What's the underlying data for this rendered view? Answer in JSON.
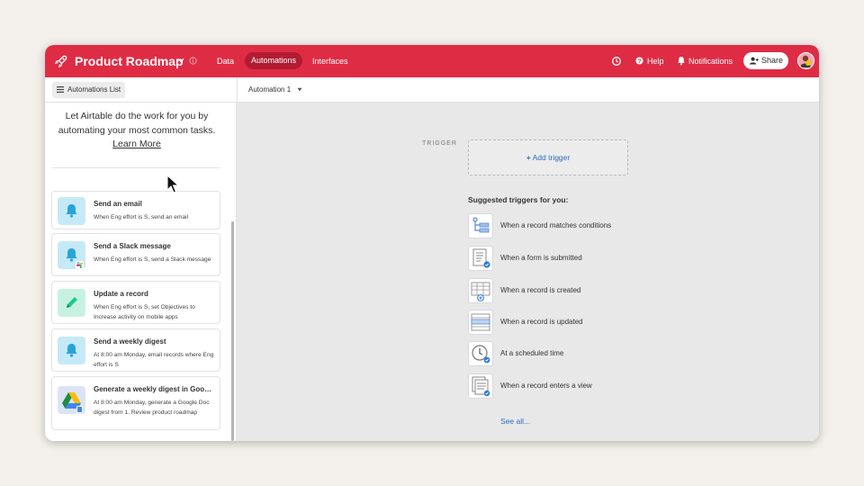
{
  "header": {
    "title": "Product Roadmap",
    "nav": [
      "Data",
      "Automations",
      "Interfaces"
    ],
    "help_label": "Help",
    "notifications_label": "Notifications",
    "share_label": "Share",
    "bg_color": "#df2c45"
  },
  "toolbar": {
    "list_label": "Automations List",
    "automation_selector": "Automation 1"
  },
  "left_panel": {
    "intro_text": "Let Airtable do the work for you by automating your most common tasks.",
    "learn_more": "Learn More",
    "templates": [
      {
        "title": "Send an email",
        "description": "When Eng effort is S, send an email",
        "icon": "bell-icon"
      },
      {
        "title": "Send a Slack message",
        "description": "When Eng effort is S, send a Slack message",
        "icon": "bell-slack-icon"
      },
      {
        "title": "Update a record",
        "description": "When Eng effort is S, set Objectives to Increase activity on mobile apps",
        "icon": "pencil-icon"
      },
      {
        "title": "Send a weekly digest",
        "description": "At 8:00 am Monday, email records where Eng effort is S",
        "icon": "bell-icon"
      },
      {
        "title": "Generate a weekly digest in Goo…",
        "description": "At 8:00 am Monday, generate a Google Doc digest from 1. Review product roadmap",
        "icon": "google-drive-icon"
      }
    ]
  },
  "canvas": {
    "trigger_label": "TRIGGER",
    "add_trigger": "Add trigger",
    "suggested_title": "Suggested triggers for you:",
    "triggers": [
      {
        "label": "When a record matches conditions",
        "icon": "conditions-icon"
      },
      {
        "label": "When a form is submitted",
        "icon": "form-icon"
      },
      {
        "label": "When a record is created",
        "icon": "record-created-icon"
      },
      {
        "label": "When a record is updated",
        "icon": "record-updated-icon"
      },
      {
        "label": "At a scheduled time",
        "icon": "clock-icon"
      },
      {
        "label": "When a record enters a view",
        "icon": "view-icon"
      }
    ],
    "see_all": "See all..."
  }
}
